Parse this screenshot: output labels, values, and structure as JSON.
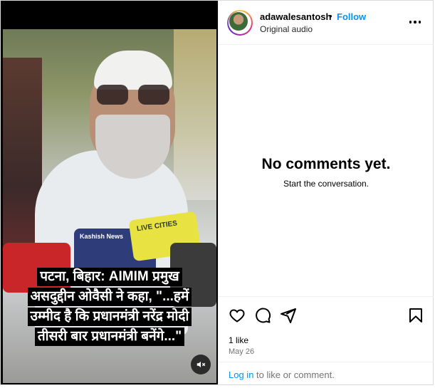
{
  "header": {
    "username": "adawalesantosh",
    "separator": "•",
    "follow_label": "Follow",
    "audio": "Original audio"
  },
  "media": {
    "caption_lines": [
      "पटना, बिहार: AIMIM प्रमुख",
      "असदुद्दीन ओवैसी ने कहा, \"...हमें",
      "उम्मीद है कि प्रधानमंत्री नरेंद्र मोदी",
      "तीसरी बार प्रधानमंत्री  बनेंगे...\""
    ],
    "mic_labels": [
      "LIVE CITIES",
      "Kashish News"
    ]
  },
  "comments": {
    "empty_title": "No comments yet.",
    "empty_subtitle": "Start the conversation."
  },
  "stats": {
    "likes": "1 like",
    "date": "May 26"
  },
  "login": {
    "link_label": "Log in",
    "rest": " to like or comment."
  },
  "icons": [
    "heart-icon",
    "comment-icon",
    "share-icon",
    "bookmark-icon",
    "more-options-icon",
    "mute-icon"
  ]
}
